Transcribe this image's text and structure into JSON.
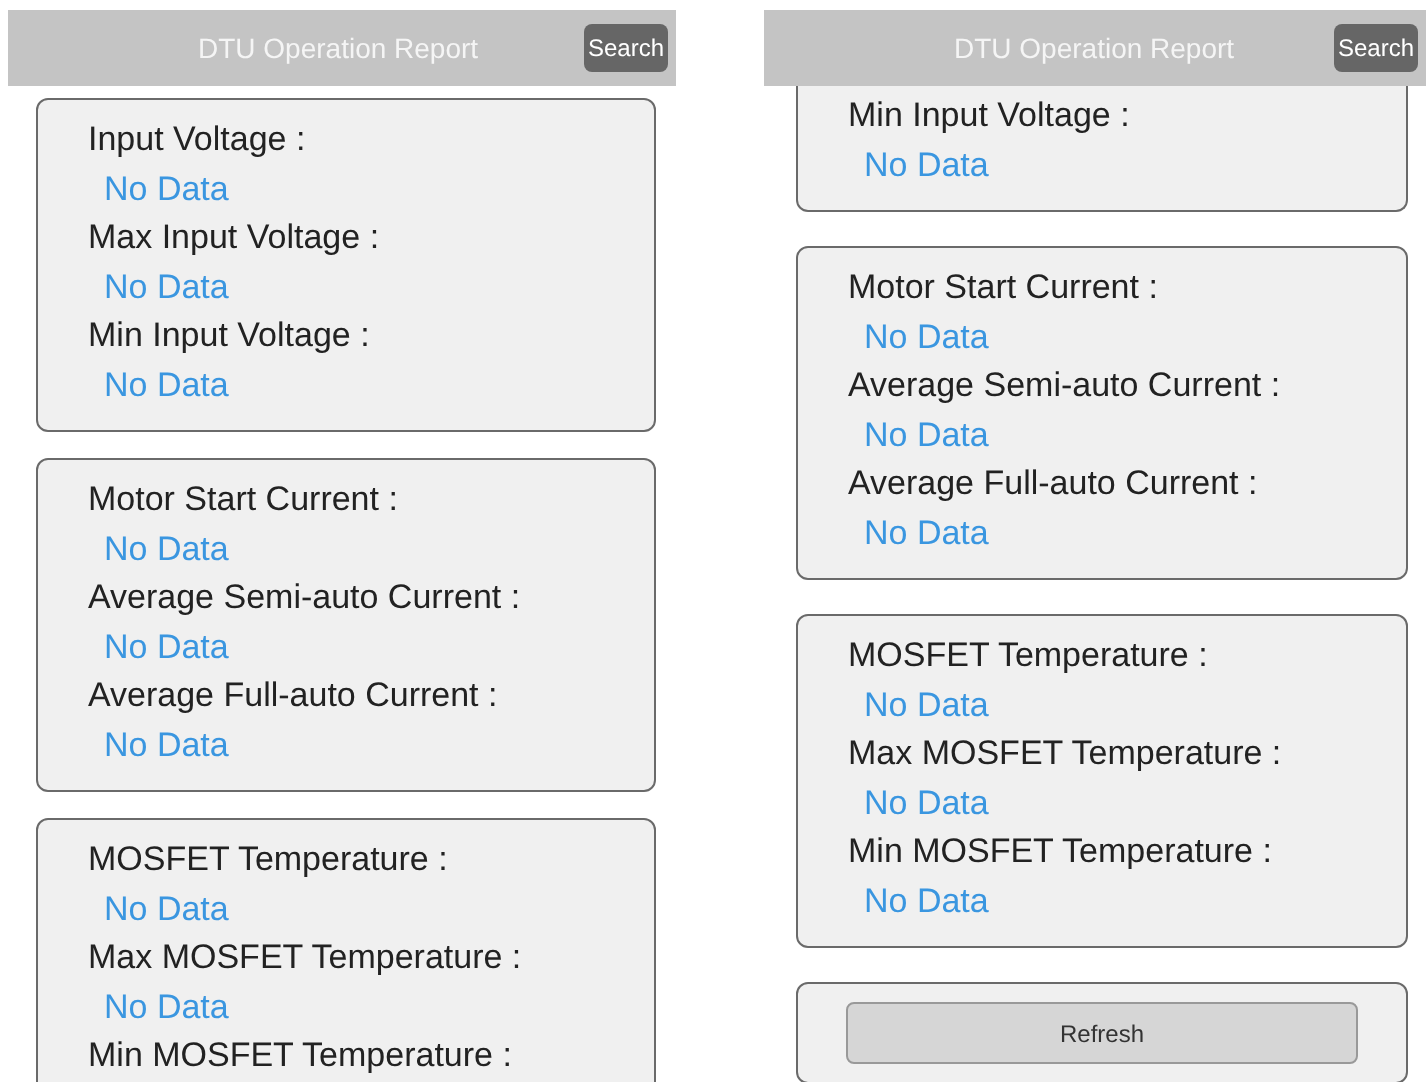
{
  "panels": [
    {
      "title": "DTU Operation Report",
      "search": "Search",
      "cards": [
        {
          "kind": "fields",
          "cut_top": false,
          "fields": [
            {
              "label": "Input Voltage :",
              "value": "No Data"
            },
            {
              "label": "Max Input Voltage :",
              "value": "No Data"
            },
            {
              "label": "Min Input Voltage :",
              "value": "No Data"
            }
          ]
        },
        {
          "kind": "fields",
          "cut_top": false,
          "fields": [
            {
              "label": "Motor Start Current :",
              "value": "No Data"
            },
            {
              "label": "Average Semi-auto Current :",
              "value": "No Data"
            },
            {
              "label": "Average Full-auto Current :",
              "value": "No Data"
            }
          ]
        },
        {
          "kind": "fields",
          "cut_top": false,
          "fields": [
            {
              "label": "MOSFET Temperature :",
              "value": "No Data"
            },
            {
              "label": "Max MOSFET Temperature :",
              "value": "No Data"
            },
            {
              "label": "Min MOSFET Temperature :"
            }
          ]
        }
      ]
    },
    {
      "title": "DTU Operation Report",
      "search": "Search",
      "cards": [
        {
          "kind": "fields",
          "cut_top": true,
          "fields": [
            {
              "label": "Min Input Voltage :",
              "value": "No Data"
            }
          ]
        },
        {
          "kind": "fields",
          "cut_top": false,
          "fields": [
            {
              "label": "Motor Start Current :",
              "value": "No Data"
            },
            {
              "label": "Average Semi-auto Current :",
              "value": "No Data"
            },
            {
              "label": "Average Full-auto Current :",
              "value": "No Data"
            }
          ]
        },
        {
          "kind": "fields",
          "cut_top": false,
          "fields": [
            {
              "label": "MOSFET Temperature :",
              "value": "No Data"
            },
            {
              "label": "Max MOSFET Temperature :",
              "value": "No Data"
            },
            {
              "label": "Min MOSFET Temperature :",
              "value": "No Data"
            }
          ]
        },
        {
          "kind": "button",
          "label": "Refresh"
        }
      ]
    }
  ]
}
